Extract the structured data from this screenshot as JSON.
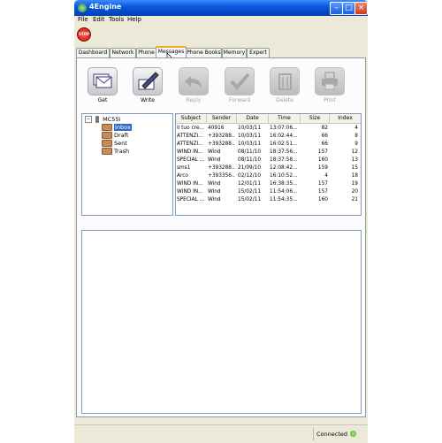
{
  "window": {
    "title": "4Engine"
  },
  "menu": [
    "File",
    "Edit",
    "Tools",
    "Help"
  ],
  "stop_label": "STOP",
  "tabs": [
    "Dashboard",
    "Network",
    "Phone",
    "Messages",
    "Phone Books",
    "Memory",
    "Expert"
  ],
  "active_tab": "Messages",
  "toolbar": [
    {
      "label": "Get",
      "icon": "envelopes-icon",
      "enabled": true
    },
    {
      "label": "Write",
      "icon": "pen-envelope-icon",
      "enabled": true
    },
    {
      "label": "Reply",
      "icon": "reply-arrow-icon",
      "enabled": false
    },
    {
      "label": "Forward",
      "icon": "forward-check-icon",
      "enabled": false
    },
    {
      "label": "Delete",
      "icon": "trash-icon",
      "enabled": false
    },
    {
      "label": "Print",
      "icon": "printer-icon",
      "enabled": false
    }
  ],
  "tree": {
    "root": "MC55i",
    "folders": [
      "Inbox",
      "Draft",
      "Sent",
      "Trash"
    ],
    "selected": "Inbox"
  },
  "table": {
    "columns": [
      "Subject",
      "Sender",
      "Date",
      "Time",
      "Size",
      "Index"
    ],
    "rows": [
      [
        "Il tuo cre...",
        "40916",
        "10/03/11",
        "13:07:06...",
        "82",
        "4"
      ],
      [
        "ATTENZI...",
        "+393288...",
        "10/03/11",
        "16:02:44...",
        "66",
        "8"
      ],
      [
        "ATTENZI...",
        "+393288...",
        "10/03/11",
        "16:02:51...",
        "66",
        "9"
      ],
      [
        "WIND IN...",
        "Wind",
        "08/11/10",
        "18:37:56...",
        "157",
        "12"
      ],
      [
        "SPECIAL ...",
        "Wind",
        "08/11/10",
        "18:37:58...",
        "160",
        "13"
      ],
      [
        "sms1",
        "+393288...",
        "21/09/10",
        "12:08:42...",
        "159",
        "15"
      ],
      [
        "Arco",
        "+393356...",
        "02/12/10",
        "16:10:52...",
        "4",
        "18"
      ],
      [
        "WIND IN...",
        "Wind",
        "12/01/11",
        "16:38:35...",
        "157",
        "19"
      ],
      [
        "WIND IN...",
        "Wind",
        "15/02/11",
        "11:54:06...",
        "157",
        "20"
      ],
      [
        "SPECIAL ...",
        "Wind",
        "15/02/11",
        "11:54:35...",
        "160",
        "21"
      ]
    ]
  },
  "status": {
    "text": "Connected",
    "color": "#3aa010"
  }
}
